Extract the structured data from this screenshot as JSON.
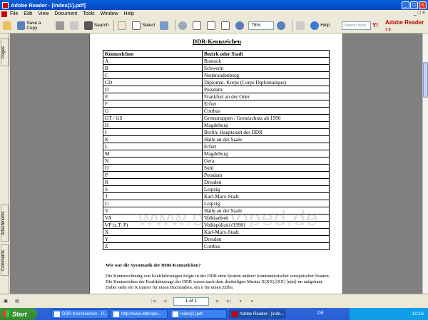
{
  "window": {
    "title": "Adobe Reader - [index[1].pdf]"
  },
  "menu": [
    "File",
    "Edit",
    "View",
    "Document",
    "Tools",
    "Window",
    "Help"
  ],
  "toolbar": {
    "save_copy": "Save a Copy",
    "search": "Search",
    "select": "Select",
    "zoom": "78%",
    "help": "Help",
    "search_web_placeholder": "Search Web",
    "brand": "Adobe Reader",
    "brand_version": "7.0"
  },
  "side_tabs": {
    "pages": "Pages",
    "attachments": "Attachments",
    "comments": "Comments"
  },
  "document": {
    "title": "DDR-Kennzeichen",
    "headers": [
      "Kennzeichen",
      "Bezirk oder Stadt"
    ],
    "rows": [
      [
        "A",
        "Rostock"
      ],
      [
        "B",
        "Schwerin"
      ],
      [
        "C",
        "Neubrandenburg"
      ],
      [
        "CD",
        "Diplomat. Korps (Corps Diplomatique)"
      ],
      [
        "D",
        "Potsdam"
      ],
      [
        "E",
        "Frankfurt an der Oder"
      ],
      [
        "F",
        "Erfurt"
      ],
      [
        "G",
        "Cottbus"
      ],
      [
        "GT / GS",
        "Grenztruppen / Grenzschutz ab 1990"
      ],
      [
        "H",
        "Magdeburg"
      ],
      [
        "I",
        "Berlin, Hauptstadt der DDR"
      ],
      [
        "K",
        "Halle an der Saale"
      ],
      [
        "L",
        "Erfurt"
      ],
      [
        "M",
        "Magdeburg"
      ],
      [
        "N",
        "Gera"
      ],
      [
        "O",
        "Suhl"
      ],
      [
        "P",
        "Potsdam"
      ],
      [
        "R",
        "Dresden"
      ],
      [
        "S",
        "Leipzig"
      ],
      [
        "T",
        "Karl-Marx-Stadt"
      ],
      [
        "U",
        "Leipzig"
      ],
      [
        "V",
        "Halle an der Saale"
      ],
      [
        "VA",
        "Volksarmee"
      ],
      [
        "VP (z.T. P)",
        "Volkspolizei (1990)"
      ],
      [
        "X",
        "Karl-Marx-Stadt"
      ],
      [
        "Y",
        "Dresden"
      ],
      [
        "Z",
        "Cottbus"
      ]
    ],
    "watermark": "www.ddmoped.de",
    "question": "Wie war die Systematik der DDR-Kennzeichen?",
    "paragraph": "Die Kennzeichnung von Kraftfahrzeugen folgte in der DDR dem System anderer kommunistischer europäischer Staaten. Die Kennzeichen der Kraftfahrzeuge der DDR waren nach dem dreiteiligen Muster X(XX) [XX] [n|m]-nn aufgebaut. Dabei steht ein X immer für einen Buchstaben, ein n für einen Ziffer."
  },
  "status": {
    "page": "1 of 1"
  },
  "taskbar": {
    "start": "Start",
    "tasks": [
      "DDR Kennzeichen - D...",
      "http://www.ddmope...",
      "index[1].pdf",
      "Adobe Reader - [inde..."
    ],
    "lang": "DE",
    "clock": "10:16"
  }
}
